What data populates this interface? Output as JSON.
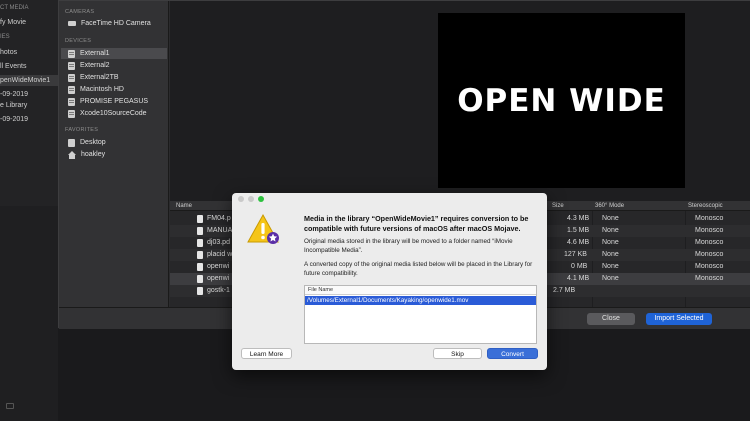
{
  "library_sidebar": {
    "rows": [
      {
        "label": "CT MEDIA",
        "kind": "hdr"
      },
      {
        "label": "fy Movie",
        "kind": "item"
      },
      {
        "label": "IES",
        "kind": "hdr"
      },
      {
        "label": "hotos",
        "kind": "item"
      },
      {
        "label": "ll Events",
        "kind": "item"
      },
      {
        "label": "penWideMovie1",
        "kind": "sel"
      },
      {
        "label": "-09-2019",
        "kind": "item"
      },
      {
        "label": "e Library",
        "kind": "item"
      },
      {
        "label": "-09-2019",
        "kind": "item"
      }
    ]
  },
  "import_sidebar": {
    "cameras_header": "CAMERAS",
    "cameras": [
      {
        "label": "FaceTime HD Camera",
        "icon": "camera-icon"
      }
    ],
    "devices_header": "DEVICES",
    "devices": [
      {
        "label": "External1",
        "icon": "drive-icon",
        "selected": true
      },
      {
        "label": "External2",
        "icon": "drive-icon"
      },
      {
        "label": "External2TB",
        "icon": "drive-icon"
      },
      {
        "label": "Macintosh HD",
        "icon": "drive-icon"
      },
      {
        "label": "PROMISE PEGASUS",
        "icon": "drive-icon"
      },
      {
        "label": "Xcode10SourceCode",
        "icon": "drive-icon"
      }
    ],
    "favorites_header": "FAVORITES",
    "favorites": [
      {
        "label": "Desktop",
        "icon": "folder-icon"
      },
      {
        "label": "hoakley",
        "icon": "home-icon"
      }
    ]
  },
  "preview": {
    "title_text": "OPEN WIDE"
  },
  "table": {
    "columns": {
      "name": "Name",
      "size": "Size",
      "mode": "360° Mode",
      "stereo": "Stereoscopic"
    },
    "rows": [
      {
        "name": "FM04.p",
        "size": "4.3 MB",
        "mode": "None",
        "stereo": "Monosco"
      },
      {
        "name": "MANUA",
        "size": "1.5 MB",
        "mode": "None",
        "stereo": "Monosco"
      },
      {
        "name": "dj03.pd",
        "size": "4.6 MB",
        "mode": "None",
        "stereo": "Monosco"
      },
      {
        "name": "placid w",
        "size": "127 KB",
        "mode": "None",
        "stereo": "Monosco"
      },
      {
        "name": "openwi",
        "size": "0 MB",
        "mode": "None",
        "stereo": "Monosco"
      },
      {
        "name": "openwi",
        "size": "4.1 MB",
        "mode": "None",
        "stereo": "Monosco"
      },
      {
        "name": "gostk-1",
        "size": "2.7 MB",
        "mode": "",
        "stereo": ""
      }
    ]
  },
  "footer": {
    "close_label": "Close",
    "import_label": "Import Selected"
  },
  "dialog": {
    "title": "Media in the library “OpenWideMovie1” requires conversion to be compatible with future versions of macOS after macOS Mojave.",
    "para1": "Original media stored in the library will be moved to a folder named “iMovie Incompatible Media”.",
    "para2": "A converted copy of the original media listed below will be placed in the Library for future compatibility.",
    "list_header": "File Name",
    "list_row": "/Volumes/External1/Documents/Kayaking/openwide1.mov",
    "learn_more": "Learn More",
    "skip": "Skip",
    "convert": "Convert"
  },
  "colors": {
    "accent": "#1f63d6",
    "selection": "#2a5bd7",
    "warning": "#f5c518"
  }
}
